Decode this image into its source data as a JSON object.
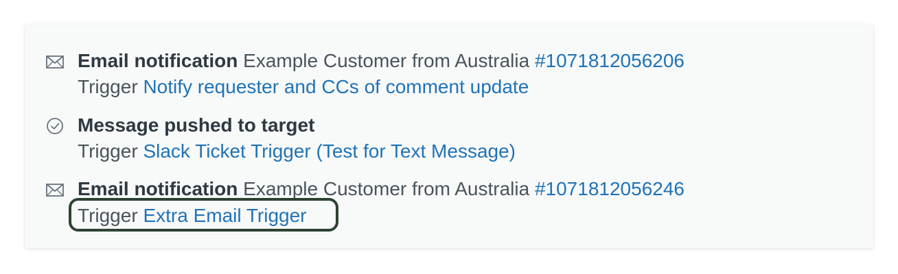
{
  "events": [
    {
      "icon": "envelope-icon",
      "title": "Email notification",
      "detail": "Example Customer from Australia",
      "ticket": "#1071812056206",
      "trigger_prefix": "Trigger",
      "trigger_name": "Notify requester and CCs of comment update"
    },
    {
      "icon": "check-circle-icon",
      "title": "Message pushed to target",
      "trigger_prefix": "Trigger",
      "trigger_name": "Slack Ticket Trigger (Test for Text Message)"
    },
    {
      "icon": "envelope-icon",
      "title": "Email notification",
      "detail": "Example Customer from Australia",
      "ticket": "#1071812056246",
      "trigger_prefix": "Trigger",
      "trigger_name": "Extra Email Trigger"
    }
  ],
  "colors": {
    "link": "#1f73b7",
    "highlight_border": "#2d4332",
    "panel_bg": "#f8f9f9"
  }
}
